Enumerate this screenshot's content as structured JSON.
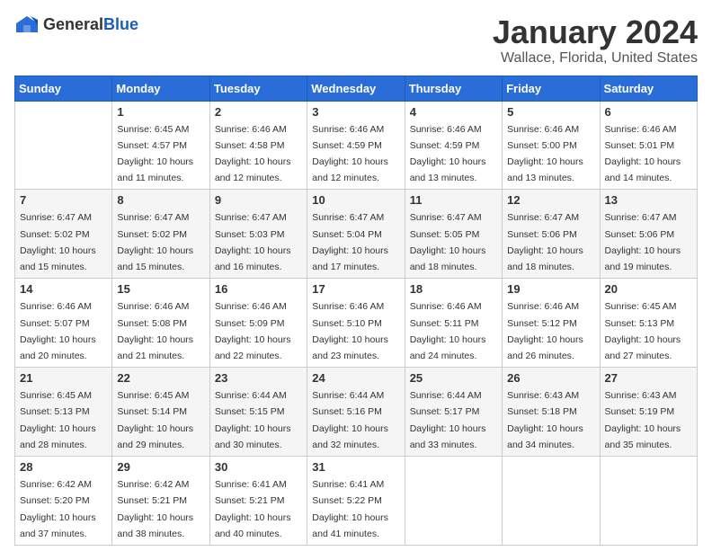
{
  "logo": {
    "general": "General",
    "blue": "Blue"
  },
  "header": {
    "month": "January 2024",
    "location": "Wallace, Florida, United States"
  },
  "weekdays": [
    "Sunday",
    "Monday",
    "Tuesday",
    "Wednesday",
    "Thursday",
    "Friday",
    "Saturday"
  ],
  "weeks": [
    [
      {
        "day": "",
        "sunrise": "",
        "sunset": "",
        "daylight": ""
      },
      {
        "day": "1",
        "sunrise": "Sunrise: 6:45 AM",
        "sunset": "Sunset: 4:57 PM",
        "daylight": "Daylight: 10 hours and 11 minutes."
      },
      {
        "day": "2",
        "sunrise": "Sunrise: 6:46 AM",
        "sunset": "Sunset: 4:58 PM",
        "daylight": "Daylight: 10 hours and 12 minutes."
      },
      {
        "day": "3",
        "sunrise": "Sunrise: 6:46 AM",
        "sunset": "Sunset: 4:59 PM",
        "daylight": "Daylight: 10 hours and 12 minutes."
      },
      {
        "day": "4",
        "sunrise": "Sunrise: 6:46 AM",
        "sunset": "Sunset: 4:59 PM",
        "daylight": "Daylight: 10 hours and 13 minutes."
      },
      {
        "day": "5",
        "sunrise": "Sunrise: 6:46 AM",
        "sunset": "Sunset: 5:00 PM",
        "daylight": "Daylight: 10 hours and 13 minutes."
      },
      {
        "day": "6",
        "sunrise": "Sunrise: 6:46 AM",
        "sunset": "Sunset: 5:01 PM",
        "daylight": "Daylight: 10 hours and 14 minutes."
      }
    ],
    [
      {
        "day": "7",
        "sunrise": "Sunrise: 6:47 AM",
        "sunset": "Sunset: 5:02 PM",
        "daylight": "Daylight: 10 hours and 15 minutes."
      },
      {
        "day": "8",
        "sunrise": "Sunrise: 6:47 AM",
        "sunset": "Sunset: 5:02 PM",
        "daylight": "Daylight: 10 hours and 15 minutes."
      },
      {
        "day": "9",
        "sunrise": "Sunrise: 6:47 AM",
        "sunset": "Sunset: 5:03 PM",
        "daylight": "Daylight: 10 hours and 16 minutes."
      },
      {
        "day": "10",
        "sunrise": "Sunrise: 6:47 AM",
        "sunset": "Sunset: 5:04 PM",
        "daylight": "Daylight: 10 hours and 17 minutes."
      },
      {
        "day": "11",
        "sunrise": "Sunrise: 6:47 AM",
        "sunset": "Sunset: 5:05 PM",
        "daylight": "Daylight: 10 hours and 18 minutes."
      },
      {
        "day": "12",
        "sunrise": "Sunrise: 6:47 AM",
        "sunset": "Sunset: 5:06 PM",
        "daylight": "Daylight: 10 hours and 18 minutes."
      },
      {
        "day": "13",
        "sunrise": "Sunrise: 6:47 AM",
        "sunset": "Sunset: 5:06 PM",
        "daylight": "Daylight: 10 hours and 19 minutes."
      }
    ],
    [
      {
        "day": "14",
        "sunrise": "Sunrise: 6:46 AM",
        "sunset": "Sunset: 5:07 PM",
        "daylight": "Daylight: 10 hours and 20 minutes."
      },
      {
        "day": "15",
        "sunrise": "Sunrise: 6:46 AM",
        "sunset": "Sunset: 5:08 PM",
        "daylight": "Daylight: 10 hours and 21 minutes."
      },
      {
        "day": "16",
        "sunrise": "Sunrise: 6:46 AM",
        "sunset": "Sunset: 5:09 PM",
        "daylight": "Daylight: 10 hours and 22 minutes."
      },
      {
        "day": "17",
        "sunrise": "Sunrise: 6:46 AM",
        "sunset": "Sunset: 5:10 PM",
        "daylight": "Daylight: 10 hours and 23 minutes."
      },
      {
        "day": "18",
        "sunrise": "Sunrise: 6:46 AM",
        "sunset": "Sunset: 5:11 PM",
        "daylight": "Daylight: 10 hours and 24 minutes."
      },
      {
        "day": "19",
        "sunrise": "Sunrise: 6:46 AM",
        "sunset": "Sunset: 5:12 PM",
        "daylight": "Daylight: 10 hours and 26 minutes."
      },
      {
        "day": "20",
        "sunrise": "Sunrise: 6:45 AM",
        "sunset": "Sunset: 5:13 PM",
        "daylight": "Daylight: 10 hours and 27 minutes."
      }
    ],
    [
      {
        "day": "21",
        "sunrise": "Sunrise: 6:45 AM",
        "sunset": "Sunset: 5:13 PM",
        "daylight": "Daylight: 10 hours and 28 minutes."
      },
      {
        "day": "22",
        "sunrise": "Sunrise: 6:45 AM",
        "sunset": "Sunset: 5:14 PM",
        "daylight": "Daylight: 10 hours and 29 minutes."
      },
      {
        "day": "23",
        "sunrise": "Sunrise: 6:44 AM",
        "sunset": "Sunset: 5:15 PM",
        "daylight": "Daylight: 10 hours and 30 minutes."
      },
      {
        "day": "24",
        "sunrise": "Sunrise: 6:44 AM",
        "sunset": "Sunset: 5:16 PM",
        "daylight": "Daylight: 10 hours and 32 minutes."
      },
      {
        "day": "25",
        "sunrise": "Sunrise: 6:44 AM",
        "sunset": "Sunset: 5:17 PM",
        "daylight": "Daylight: 10 hours and 33 minutes."
      },
      {
        "day": "26",
        "sunrise": "Sunrise: 6:43 AM",
        "sunset": "Sunset: 5:18 PM",
        "daylight": "Daylight: 10 hours and 34 minutes."
      },
      {
        "day": "27",
        "sunrise": "Sunrise: 6:43 AM",
        "sunset": "Sunset: 5:19 PM",
        "daylight": "Daylight: 10 hours and 35 minutes."
      }
    ],
    [
      {
        "day": "28",
        "sunrise": "Sunrise: 6:42 AM",
        "sunset": "Sunset: 5:20 PM",
        "daylight": "Daylight: 10 hours and 37 minutes."
      },
      {
        "day": "29",
        "sunrise": "Sunrise: 6:42 AM",
        "sunset": "Sunset: 5:21 PM",
        "daylight": "Daylight: 10 hours and 38 minutes."
      },
      {
        "day": "30",
        "sunrise": "Sunrise: 6:41 AM",
        "sunset": "Sunset: 5:21 PM",
        "daylight": "Daylight: 10 hours and 40 minutes."
      },
      {
        "day": "31",
        "sunrise": "Sunrise: 6:41 AM",
        "sunset": "Sunset: 5:22 PM",
        "daylight": "Daylight: 10 hours and 41 minutes."
      },
      {
        "day": "",
        "sunrise": "",
        "sunset": "",
        "daylight": ""
      },
      {
        "day": "",
        "sunrise": "",
        "sunset": "",
        "daylight": ""
      },
      {
        "day": "",
        "sunrise": "",
        "sunset": "",
        "daylight": ""
      }
    ]
  ]
}
